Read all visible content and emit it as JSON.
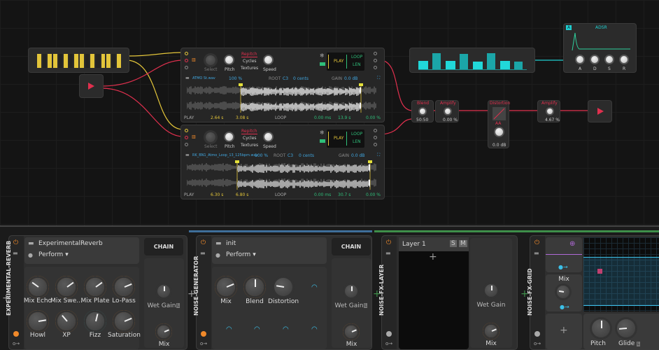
{
  "colors": {
    "accent_orange": "#f0892a",
    "cable_red": "#e0304e",
    "cable_yellow": "#e3c53a",
    "teal": "#1fcfd0",
    "green": "#39b36a",
    "blue": "#41a7e0"
  },
  "samplers": [
    {
      "mode": "Repitch",
      "modes": [
        "Cycles",
        "Textures"
      ],
      "knobs": [
        "Select",
        "Pitch",
        "Speed"
      ],
      "play": "PLAY",
      "loop": "LOOP",
      "len": "LEN",
      "file": "ATMO St.wav",
      "speed_pct": "100 %",
      "root_label": "ROOT",
      "root": "C3",
      "cents": "0 cents",
      "gain_label": "GAIN",
      "gain": "0.0 dB",
      "play_label": "PLAY",
      "start": "2.64 s",
      "end": "3.08 s",
      "loop_label": "LOOP",
      "fade": "0.00 ms",
      "length": "13.9 s",
      "pct": "0.00 %"
    },
    {
      "mode": "Repitch",
      "modes": [
        "Cycles",
        "Textures"
      ],
      "knobs": [
        "Select",
        "Pitch",
        "Speed"
      ],
      "play": "PLAY",
      "loop": "LOOP",
      "len": "LEN",
      "file": "RK_BN1_Atmo_Loop_13_125bpm.wav",
      "speed_pct": "100 %",
      "root_label": "ROOT",
      "root": "C3",
      "cents": "0 cents",
      "gain_label": "GAIN",
      "gain": "0.0 dB",
      "play_label": "PLAY",
      "start": "6.30 s",
      "end": "6.80 s",
      "loop_label": "LOOP",
      "fade": "0.00 ms",
      "length": "30.7 s",
      "pct": "0.00 %"
    }
  ],
  "steps": [
    0.45,
    0.85,
    0.45,
    0.8,
    0.42,
    0.85,
    0.45,
    0.42
  ],
  "adsr": {
    "title": "ADSR",
    "badge": "A",
    "knobs": [
      "A",
      "D",
      "S",
      "R"
    ]
  },
  "fx": {
    "blend": {
      "title": "Blend",
      "value": "50:50"
    },
    "amplify1": {
      "title": "Amplify",
      "value": "0.00 %"
    },
    "distortion": {
      "title": "Distortion",
      "sub": "AA",
      "value": "0.0 dB"
    },
    "amplify2": {
      "title": "Amplify",
      "value": "4.67 %"
    }
  },
  "devices": [
    {
      "name": "EXPERIMENTAL-REVERB",
      "preset": "ExperimentalReverb",
      "page": "Perform ▾",
      "chain": "CHAIN",
      "wet": "Wet Gain",
      "mix": "Mix",
      "knobs": [
        {
          "label": "Mix Echo",
          "v": 0.3
        },
        {
          "label": "Mix Swe...",
          "v": 0.7
        },
        {
          "label": "Mix Plate",
          "v": 0.7
        },
        {
          "label": "Lo-Pass",
          "v": 0.75
        },
        {
          "label": "Howl",
          "v": 0.8
        },
        {
          "label": "XP",
          "v": 0.35
        },
        {
          "label": "Fizz",
          "v": 0.55
        },
        {
          "label": "Saturation",
          "v": 0.75
        }
      ]
    },
    {
      "name": "NOISE-GENERATOR",
      "preset": "init",
      "page": "Perform ▾",
      "chain": "CHAIN",
      "wet": "Wet Gain",
      "mix": "Mix",
      "knobs": [
        {
          "label": "Mix",
          "v": 0.75
        },
        {
          "label": "Blend",
          "v": 0.5
        },
        {
          "label": "Distortion",
          "v": 0.2
        }
      ]
    },
    {
      "name": "NOISE-FX-LAYER",
      "layer": "Layer 1",
      "solo": "S",
      "mute": "M",
      "wet": "Wet Gain",
      "mix": "Mix"
    },
    {
      "name": "NOISE-FX-GRID",
      "mix": "Mix",
      "pitch": "Pitch",
      "glide": "Glide",
      "l": "L"
    }
  ],
  "l_badge": "L"
}
